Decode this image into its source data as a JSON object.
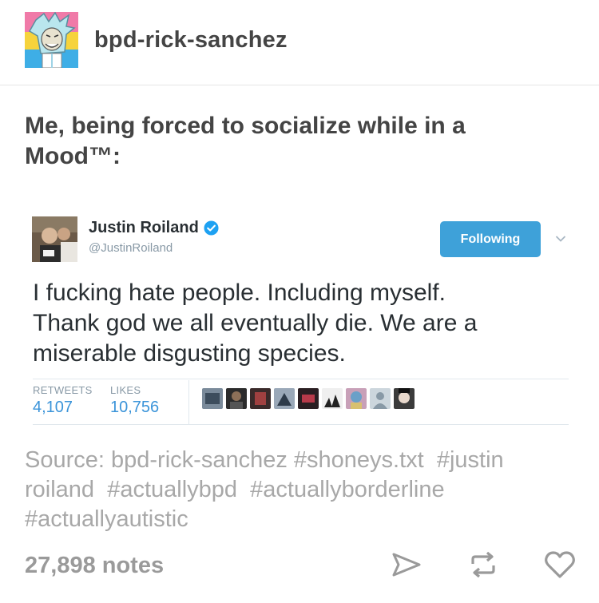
{
  "post": {
    "blog_name": "bpd-rick-sanchez",
    "caption_line1": "Me, being forced to socialize while in a",
    "caption_line2": "Mood™:"
  },
  "tweet": {
    "name": "Justin Roiland",
    "handle": "@JustinRoiland",
    "follow_label": "Following",
    "text_line1": "I fucking hate people. Including myself.",
    "text_line2": "Thank god we all eventually die. We are a",
    "text_line3": "miserable disgusting species.",
    "retweets_label": "RETWEETS",
    "retweets_value": "4,107",
    "likes_label": "LIKES",
    "likes_value": "10,756",
    "colors": {
      "follow_button": "#3ea1d9",
      "stat_value": "#3b94d9"
    }
  },
  "source": {
    "prefix": "Source:",
    "blog": "bpd-rick-sanchez",
    "tags": [
      "#shoneys.txt",
      "#justin roiland",
      "#actuallybpd",
      "#actuallyborderline",
      "#actuallyautistic"
    ]
  },
  "footer": {
    "notes": "27,898 notes",
    "icons": [
      "send-icon",
      "reblog-icon",
      "heart-icon"
    ]
  }
}
